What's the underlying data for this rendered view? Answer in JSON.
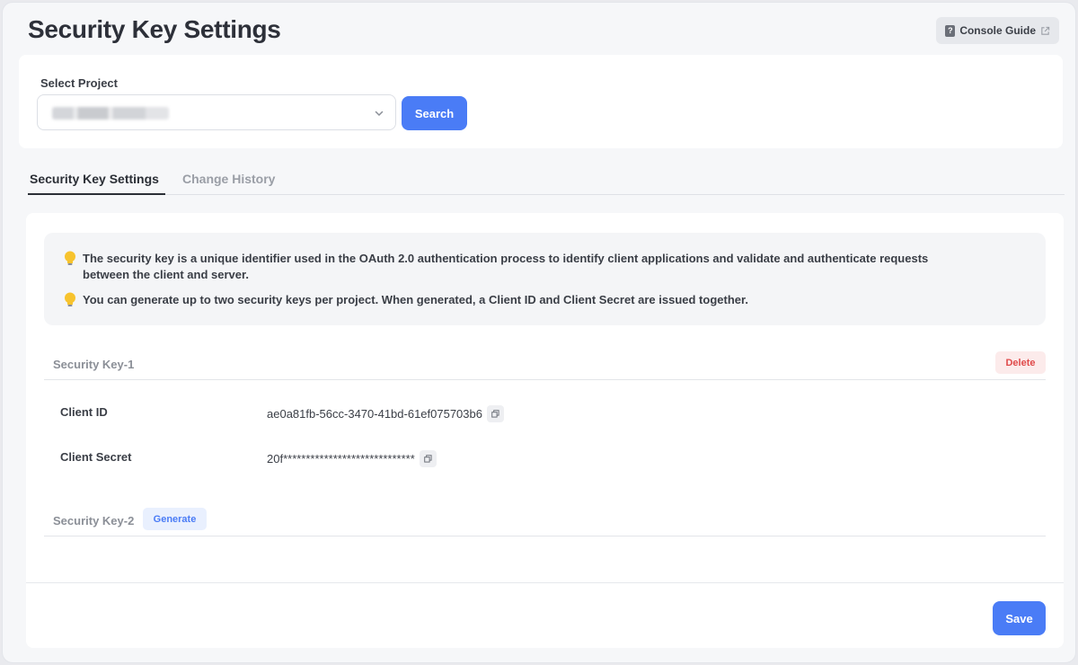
{
  "header": {
    "title": "Security Key Settings",
    "guide_label": "Console Guide"
  },
  "project": {
    "label": "Select Project",
    "selected_value": "",
    "search_label": "Search"
  },
  "tabs": [
    {
      "label": "Security Key Settings",
      "active": true
    },
    {
      "label": "Change History",
      "active": false
    }
  ],
  "info": [
    "The security key is a unique identifier used in the OAuth 2.0 authentication process to identify client applications and validate and authenticate requests between the client and server.",
    "You can generate up to two security keys per project. When generated, a Client ID and Client Secret are issued together."
  ],
  "keys": [
    {
      "title": "Security Key-1",
      "action_label": "Delete",
      "client_id_label": "Client ID",
      "client_id": "ae0a81fb-56cc-3470-41bd-61ef075703b6",
      "client_secret_label": "Client Secret",
      "client_secret": "20f*****************************"
    },
    {
      "title": "Security Key-2",
      "action_label": "Generate"
    }
  ],
  "footer": {
    "save_label": "Save"
  },
  "colors": {
    "primary": "#4a7cf6",
    "danger": "#e04b4b",
    "background": "#f6f7f9"
  },
  "icons": [
    "document-icon",
    "external-link-icon",
    "chevron-down-icon",
    "lightbulb-icon",
    "copy-icon"
  ]
}
